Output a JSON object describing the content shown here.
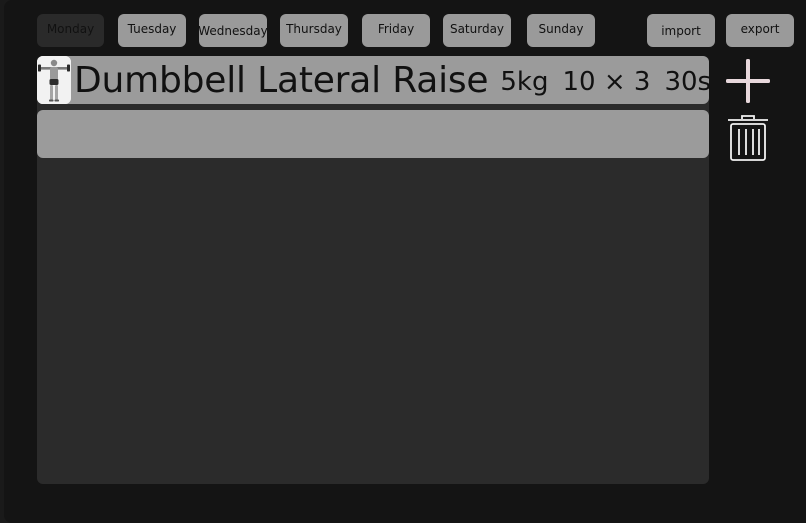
{
  "days": [
    "Monday",
    "Tuesday",
    "Wednesday",
    "Thursday",
    "Friday",
    "Saturday",
    "Sunday"
  ],
  "active_day": "Monday",
  "actions": {
    "import_label": "import",
    "export_label": "export"
  },
  "exercise": {
    "name": "Dumbbell Lateral Raise",
    "weight": "5kg",
    "sets": "10 × 3",
    "rest": "30s",
    "thumbnail_icon": "dumbbell-lateral-raise-figure"
  },
  "side_icons": {
    "add": "plus-icon",
    "delete": "trash-icon"
  },
  "colors": {
    "background": "#141414",
    "panel": "#2b2b2b",
    "row": "#9b9b9b",
    "tab": "#9a9a9a",
    "tab_active": "#2a2a2a",
    "icon_tint": "#e8d8dc"
  }
}
